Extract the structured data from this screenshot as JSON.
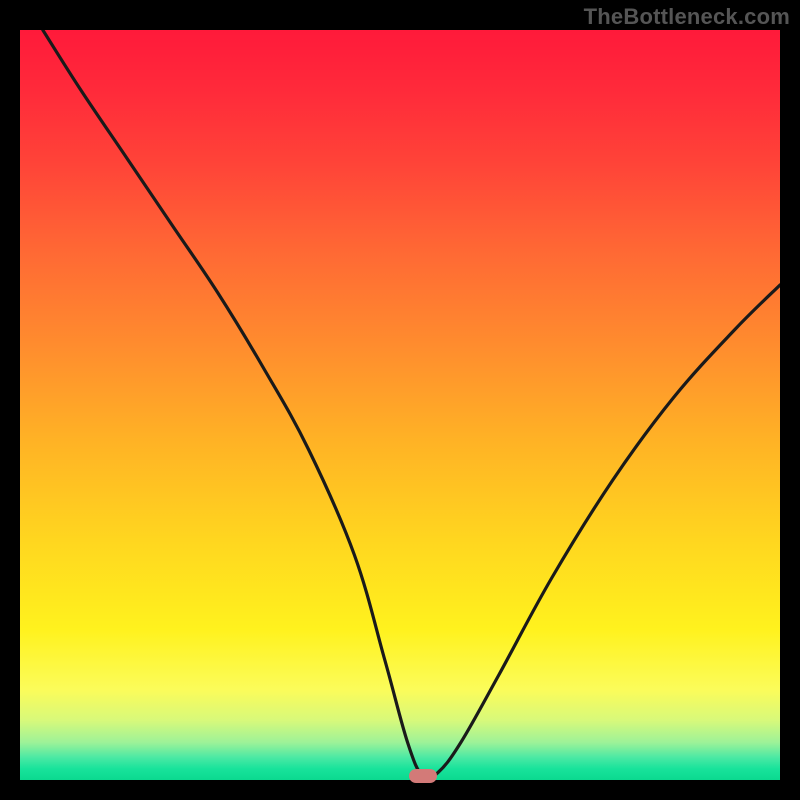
{
  "watermark": "TheBottleneck.com",
  "colors": {
    "frame_bg": "#000000",
    "curve_stroke": "#1a1a1a",
    "marker_fill": "#d37a78",
    "gradient_top": "#ff1a3a",
    "gradient_bottom": "#0bd98f"
  },
  "chart_data": {
    "type": "line",
    "title": "",
    "xlabel": "",
    "ylabel": "",
    "xlim": [
      0,
      100
    ],
    "ylim": [
      0,
      100
    ],
    "grid": false,
    "legend": false,
    "annotations": [
      {
        "kind": "marker",
        "x": 53,
        "y": 0.5,
        "shape": "pill",
        "color": "#d37a78"
      }
    ],
    "series": [
      {
        "name": "bottleneck-curve",
        "color": "#1a1a1a",
        "x": [
          3,
          8,
          14,
          20,
          26,
          32,
          38,
          44,
          48,
          51,
          53,
          55,
          58,
          63,
          70,
          78,
          86,
          94,
          100
        ],
        "y": [
          100,
          92,
          83,
          74,
          65,
          55,
          44,
          30,
          16,
          5,
          0.5,
          1,
          5,
          14,
          27,
          40,
          51,
          60,
          66
        ]
      }
    ]
  }
}
